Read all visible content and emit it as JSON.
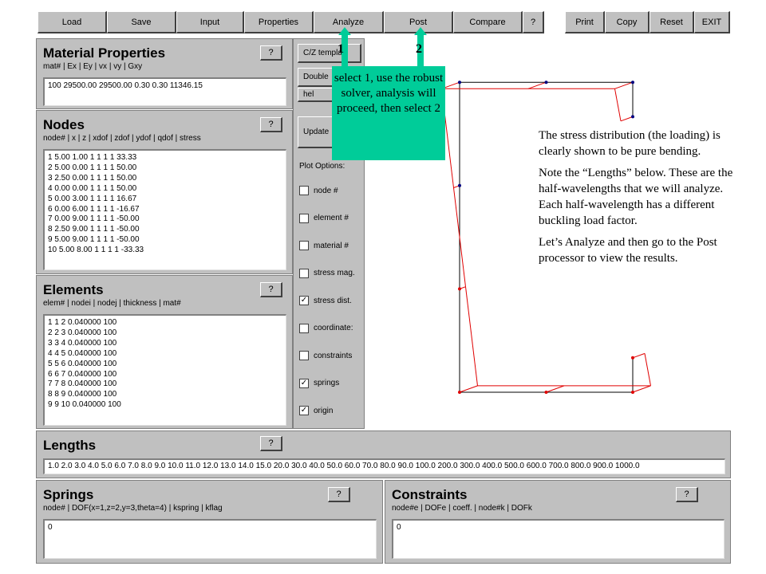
{
  "toolbar": {
    "load": "Load",
    "save": "Save",
    "input": "Input",
    "properties": "Properties",
    "analyze": "Analyze",
    "post": "Post",
    "compare": "Compare",
    "help": "?",
    "print": "Print",
    "copy": "Copy",
    "reset": "Reset",
    "exit": "EXIT"
  },
  "material": {
    "title": "Material Properties",
    "subtitle": "mat# | Ex | Ey | vx | vy | Gxy",
    "help": "?",
    "value": "100 29500.00 29500.00 0.30 0.30 11346.15"
  },
  "nodes": {
    "title": "Nodes",
    "subtitle": "node# | x | z | xdof | zdof | ydof | qdof | stress",
    "help": "?",
    "rows": [
      "1 5.00 1.00 1 1 1 1 33.33",
      "2 5.00 0.00 1 1 1 1 50.00",
      "3 2.50 0.00 1 1 1 1 50.00",
      "4 0.00 0.00 1 1 1 1 50.00",
      "5 0.00 3.00 1 1 1 1 16.67",
      "6 0.00 6.00 1 1 1 1 -16.67",
      "7 0.00 9.00 1 1 1 1 -50.00",
      "8 2.50 9.00 1 1 1 1 -50.00",
      "9 5.00 9.00 1 1 1 1 -50.00",
      "10 5.00 8.00 1 1 1 1 -33.33"
    ]
  },
  "elements": {
    "title": "Elements",
    "subtitle": "elem# | nodei | nodej | thickness | mat#",
    "help": "?",
    "rows": [
      "1 1 2 0.040000 100",
      "2 2 3 0.040000 100",
      "3 3 4 0.040000 100",
      "4 4 5 0.040000 100",
      "5 5 6 0.040000 100",
      "6 6 7 0.040000 100",
      "7 7 8 0.040000 100",
      "8 8 9 0.040000 100",
      "9 9 10 0.040000 100"
    ]
  },
  "side": {
    "template_btn": "C/Z templa",
    "double_btn": "Double",
    "help_btn": "hel",
    "update_btn": "Update",
    "plot_options_label": "Plot Options:",
    "options": [
      {
        "label": "node #",
        "checked": false
      },
      {
        "label": "element #",
        "checked": false
      },
      {
        "label": "material #",
        "checked": false
      },
      {
        "label": "stress mag.",
        "checked": false
      },
      {
        "label": "stress dist.",
        "checked": true
      },
      {
        "label": "coordinate:",
        "checked": false
      },
      {
        "label": "constraints",
        "checked": false
      },
      {
        "label": "springs",
        "checked": true
      },
      {
        "label": "origin",
        "checked": true
      }
    ]
  },
  "callout": {
    "marker1": "1",
    "marker2": "2",
    "text": "select 1, use the robust solver, analysis will proceed, then select 2",
    "color": "#00cc99"
  },
  "note": {
    "p1": "The stress distribution (the loading) is clearly shown to be pure bending.",
    "p2": "Note the “Lengths” below. These are the half-wavelengths that we will analyze. Each half-wavelength has a different buckling load factor.",
    "p3": "Let’s Analyze and then go to the Post processor to view the results."
  },
  "lengths": {
    "title": "Lengths",
    "help": "?",
    "value": "1.0 2.0 3.0 4.0 5.0 6.0 7.0 8.0 9.0 10.0 11.0 12.0 13.0 14.0 15.0 20.0 30.0 40.0 50.0 60.0 70.0 80.0 90.0 100.0 200.0 300.0 400.0 500.0 600.0 700.0 800.0 900.0 1000.0"
  },
  "springs": {
    "title": "Springs",
    "subtitle": "node# | DOF(x=1,z=2,y=3,theta=4) | kspring | kflag",
    "help": "?",
    "value": "0"
  },
  "constraints": {
    "title": "Constraints",
    "subtitle": "node#e | DOFe | coeff. | node#k | DOFk",
    "help": "?",
    "value": "0"
  },
  "colors": {
    "stress": "#e00000",
    "section": "#000000",
    "node": "#000080",
    "panel": "#c0c0c0"
  }
}
